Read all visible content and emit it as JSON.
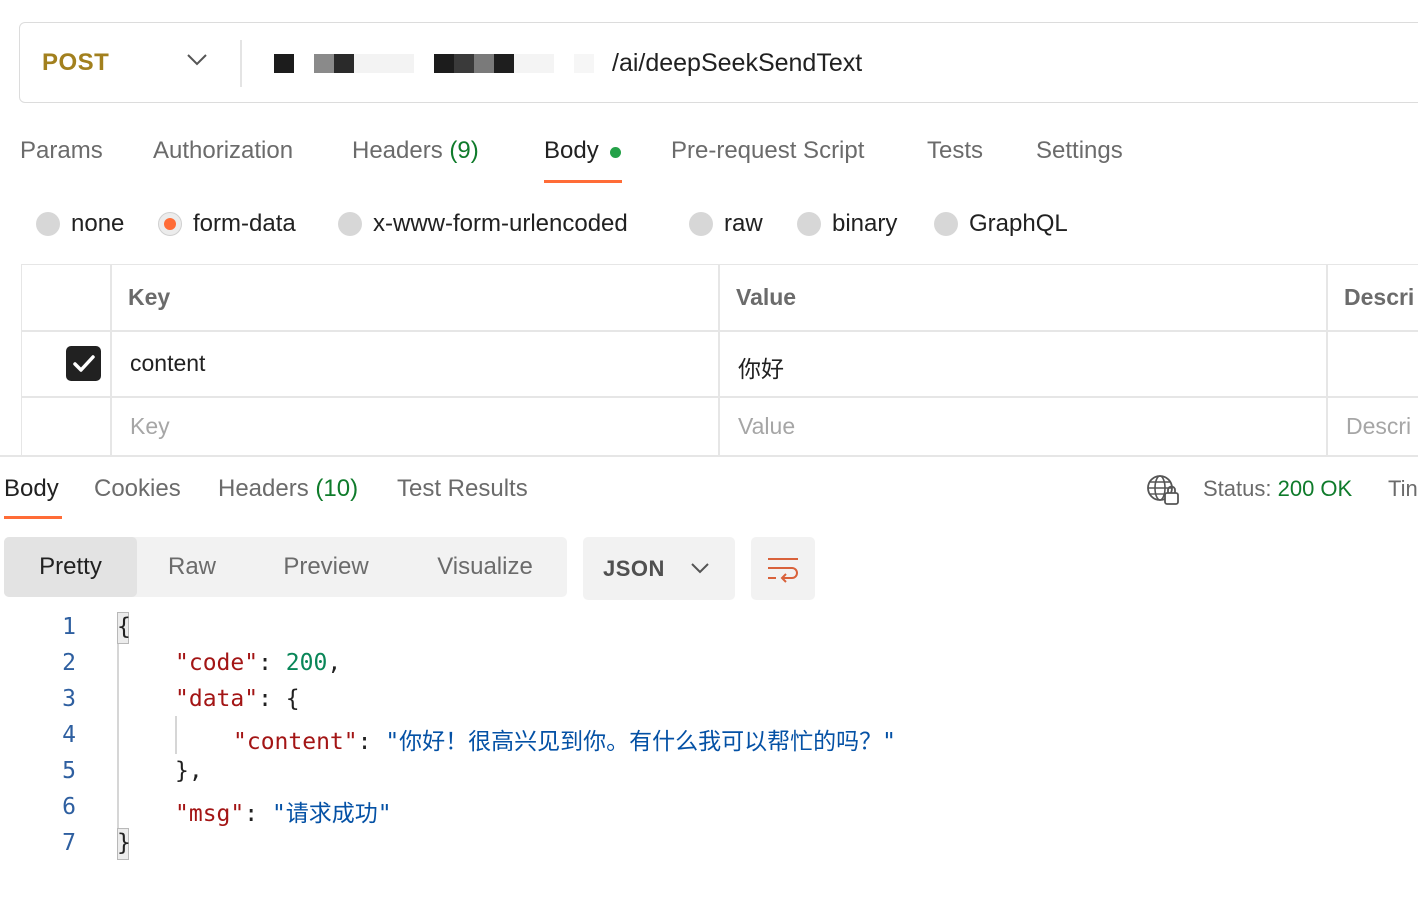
{
  "request": {
    "method": "POST",
    "url_path": "/ai/deepSeekSendText"
  },
  "request_tabs": [
    {
      "label": "Params"
    },
    {
      "label": "Authorization"
    },
    {
      "label": "Headers",
      "count": "(9)"
    },
    {
      "label": "Body"
    },
    {
      "label": "Pre-request Script"
    },
    {
      "label": "Tests"
    },
    {
      "label": "Settings"
    }
  ],
  "active_request_tab": "Body",
  "body_types": [
    "none",
    "form-data",
    "x-www-form-urlencoded",
    "raw",
    "binary",
    "GraphQL"
  ],
  "selected_body_type": "form-data",
  "kv_table": {
    "headers": {
      "key": "Key",
      "value": "Value",
      "description": "Descri"
    },
    "rows": [
      {
        "checked": true,
        "key": "content",
        "value": "你好",
        "description": ""
      }
    ],
    "placeholder": {
      "key": "Key",
      "value": "Value",
      "description": "Descri"
    }
  },
  "response": {
    "tabs": [
      {
        "label": "Body"
      },
      {
        "label": "Cookies"
      },
      {
        "label": "Headers",
        "count": "(10)"
      },
      {
        "label": "Test Results"
      }
    ],
    "active_tab": "Body",
    "status_label": "Status:",
    "status_value": "200 OK",
    "time_label": "Tin",
    "view_modes": [
      "Pretty",
      "Raw",
      "Preview",
      "Visualize"
    ],
    "active_view": "Pretty",
    "format": "JSON",
    "line_numbers": [
      "1",
      "2",
      "3",
      "4",
      "5",
      "6",
      "7"
    ],
    "json": {
      "code_key": "\"code\"",
      "code_value": "200",
      "data_key": "\"data\"",
      "content_key": "\"content\"",
      "content_value": "\"你好！很高兴见到你。有什么我可以帮忙的吗？\"",
      "msg_key": "\"msg\"",
      "msg_value": "\"请求成功\""
    }
  },
  "colors": {
    "accent": "#ff6c37",
    "method": "#a2801e",
    "success": "#0f7b2b",
    "json_key": "#a31515",
    "json_number": "#098658",
    "json_string": "#0451a5"
  }
}
